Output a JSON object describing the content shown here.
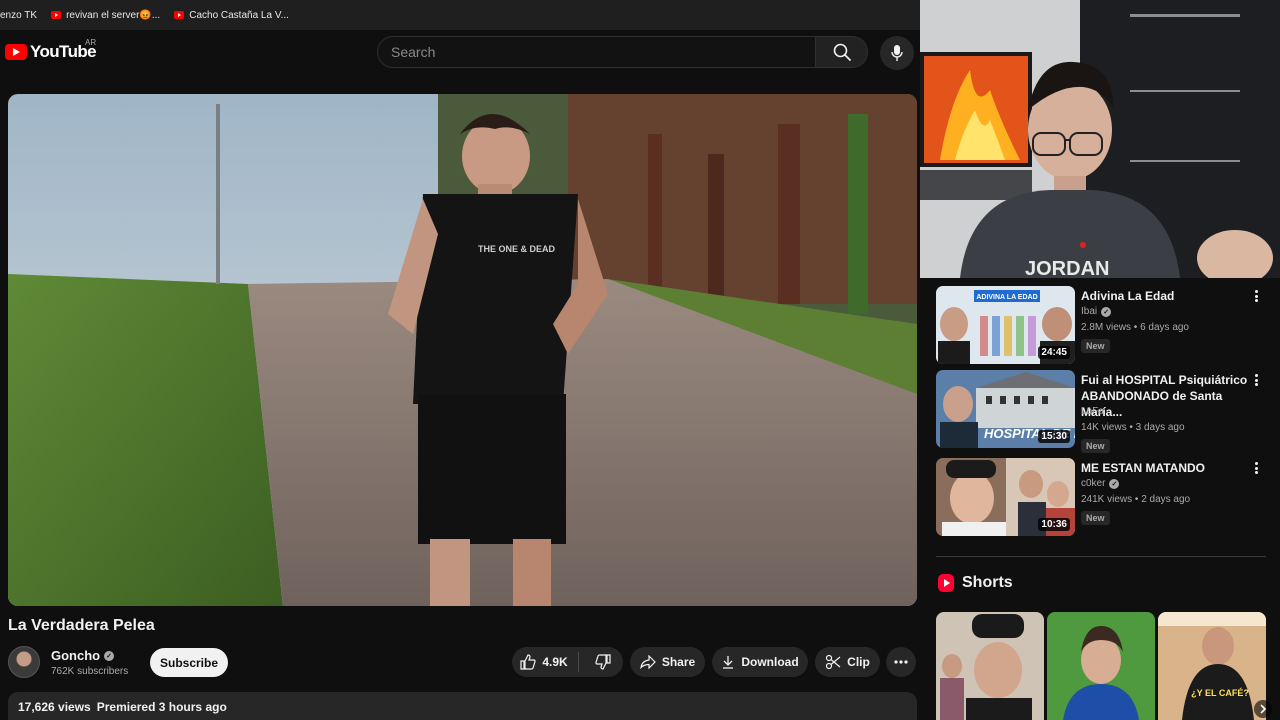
{
  "bookmarks": [
    {
      "label": "enzo TK"
    },
    {
      "label": "revivan el server😡..."
    },
    {
      "label": "Cacho Castaña La V..."
    }
  ],
  "masthead": {
    "logo_text": "YouTube",
    "country": "AR",
    "search_placeholder": "Search"
  },
  "video": {
    "title": "La Verdadera Pelea",
    "channel": "Goncho",
    "subscribers": "762K subscribers",
    "subscribe_label": "Subscribe",
    "likes": "4.9K",
    "share_label": "Share",
    "download_label": "Download",
    "clip_label": "Clip",
    "views": "17,626 views",
    "premiered": "Premiered 3 hours ago",
    "shirt_text": "THE ONE & DEAD"
  },
  "recommendations": [
    {
      "title": "Adivina La Edad",
      "channel": "Ibai",
      "verified": true,
      "meta": "2.8M views • 6 days ago",
      "badge": "New",
      "duration": "24:45",
      "thumb_text": "ADIVINA LA EDAD"
    },
    {
      "title": "Fui al HOSPITAL Psiquiátrico ABANDONADO de Santa María...",
      "channel": "LoFa",
      "verified": false,
      "meta": "14K views • 3 days ago",
      "badge": "New",
      "duration": "15:30",
      "thumb_text": "HOSPITAL DE PUN"
    },
    {
      "title": "ME ESTAN MATANDO",
      "channel": "c0ker",
      "verified": true,
      "meta": "241K views • 2 days ago",
      "badge": "New",
      "duration": "10:36",
      "thumb_text": ""
    }
  ],
  "shorts": {
    "title": "Shorts",
    "items": [
      {
        "caption": ""
      },
      {
        "caption": ""
      },
      {
        "caption": "¿Y EL CAFÉ?"
      }
    ]
  },
  "webcam": {
    "shirt_text": "JORDAN"
  },
  "colors": {
    "background": "#0f0f0f",
    "brand_red": "#ff0000",
    "pill": "#272727",
    "muted_text": "#aaaaaa"
  }
}
